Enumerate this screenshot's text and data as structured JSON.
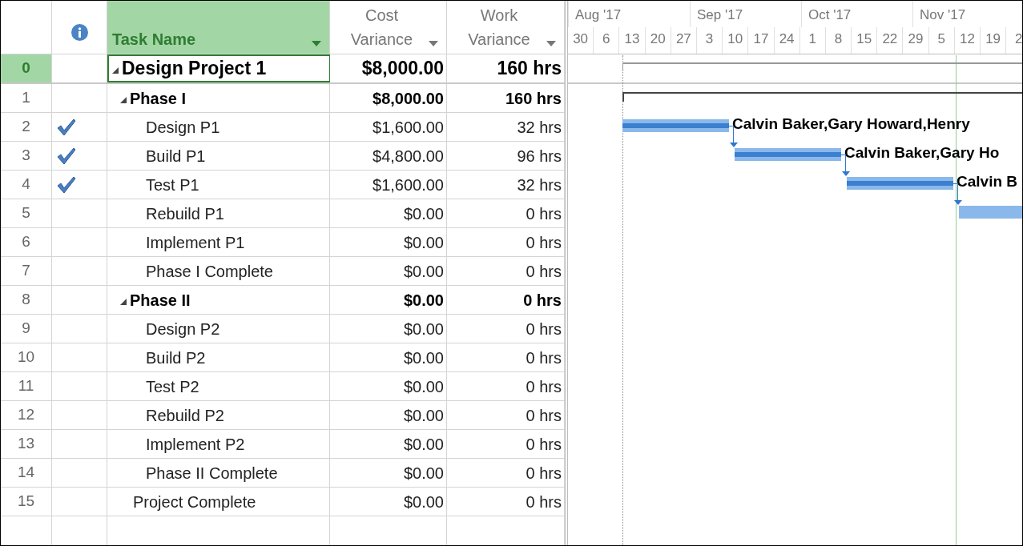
{
  "columns": [
    {
      "kind": "id"
    },
    {
      "kind": "info"
    },
    {
      "label": "Task Name",
      "kind": "name",
      "selected": true
    },
    {
      "label": "Cost Variance",
      "kind": "number"
    },
    {
      "label": "Work Variance",
      "kind": "number"
    }
  ],
  "tasks": [
    {
      "id": "0",
      "name": "Design Project 1",
      "cost_variance": "$8,000.00",
      "work_variance": "160 hrs",
      "complete": false,
      "selected": true,
      "expanded": true,
      "children": [
        {
          "id": "1",
          "name": "Phase I",
          "cost_variance": "$8,000.00",
          "work_variance": "160 hrs",
          "complete": false,
          "selected": false,
          "expanded": true,
          "children": [
            {
              "id": "2",
              "name": "Design P1",
              "cost_variance": "$1,600.00",
              "work_variance": "32 hrs",
              "complete": true,
              "selected": false
            },
            {
              "id": "3",
              "name": "Build P1",
              "cost_variance": "$4,800.00",
              "work_variance": "96 hrs",
              "complete": true,
              "selected": false
            },
            {
              "id": "4",
              "name": "Test P1",
              "cost_variance": "$1,600.00",
              "work_variance": "32 hrs",
              "complete": true,
              "selected": false
            },
            {
              "id": "5",
              "name": "Rebuild P1",
              "cost_variance": "$0.00",
              "work_variance": "0 hrs",
              "complete": false,
              "selected": false
            },
            {
              "id": "6",
              "name": "Implement P1",
              "cost_variance": "$0.00",
              "work_variance": "0 hrs",
              "complete": false,
              "selected": false
            },
            {
              "id": "7",
              "name": "Phase I Complete",
              "cost_variance": "$0.00",
              "work_variance": "0 hrs",
              "complete": false,
              "selected": false
            }
          ]
        },
        {
          "id": "8",
          "name": "Phase II",
          "cost_variance": "$0.00",
          "work_variance": "0 hrs",
          "complete": false,
          "selected": false,
          "expanded": true,
          "children": [
            {
              "id": "9",
              "name": "Design P2",
              "cost_variance": "$0.00",
              "work_variance": "0 hrs",
              "complete": false,
              "selected": false
            },
            {
              "id": "10",
              "name": "Build P2",
              "cost_variance": "$0.00",
              "work_variance": "0 hrs",
              "complete": false,
              "selected": false
            },
            {
              "id": "11",
              "name": "Test P2",
              "cost_variance": "$0.00",
              "work_variance": "0 hrs",
              "complete": false,
              "selected": false
            },
            {
              "id": "12",
              "name": "Rebuild P2",
              "cost_variance": "$0.00",
              "work_variance": "0 hrs",
              "complete": false,
              "selected": false
            },
            {
              "id": "13",
              "name": "Implement P2",
              "cost_variance": "$0.00",
              "work_variance": "0 hrs",
              "complete": false,
              "selected": false
            },
            {
              "id": "14",
              "name": "Phase II Complete",
              "cost_variance": "$0.00",
              "work_variance": "0 hrs",
              "complete": false,
              "selected": false
            }
          ]
        },
        {
          "id": "15",
          "name": "Project Complete",
          "cost_variance": "$0.00",
          "work_variance": "0 hrs",
          "complete": false,
          "selected": false
        }
      ]
    }
  ],
  "timescale": {
    "months": [
      "Aug '17",
      "Sep '17",
      "Oct '17",
      "Nov '17"
    ],
    "weeks": [
      "30",
      "6",
      "13",
      "20",
      "27",
      "3",
      "10",
      "17",
      "24",
      "1",
      "8",
      "15",
      "22",
      "29",
      "5",
      "12",
      "19",
      "2"
    ]
  },
  "gantt_bars": [
    {
      "kind": "complete",
      "label": "Calvin Baker,Gary Howard,Henry"
    },
    {
      "kind": "complete",
      "label": "Calvin Baker,Gary Ho"
    },
    {
      "kind": "complete",
      "label": "Calvin B"
    },
    {
      "kind": "not_started"
    }
  ]
}
